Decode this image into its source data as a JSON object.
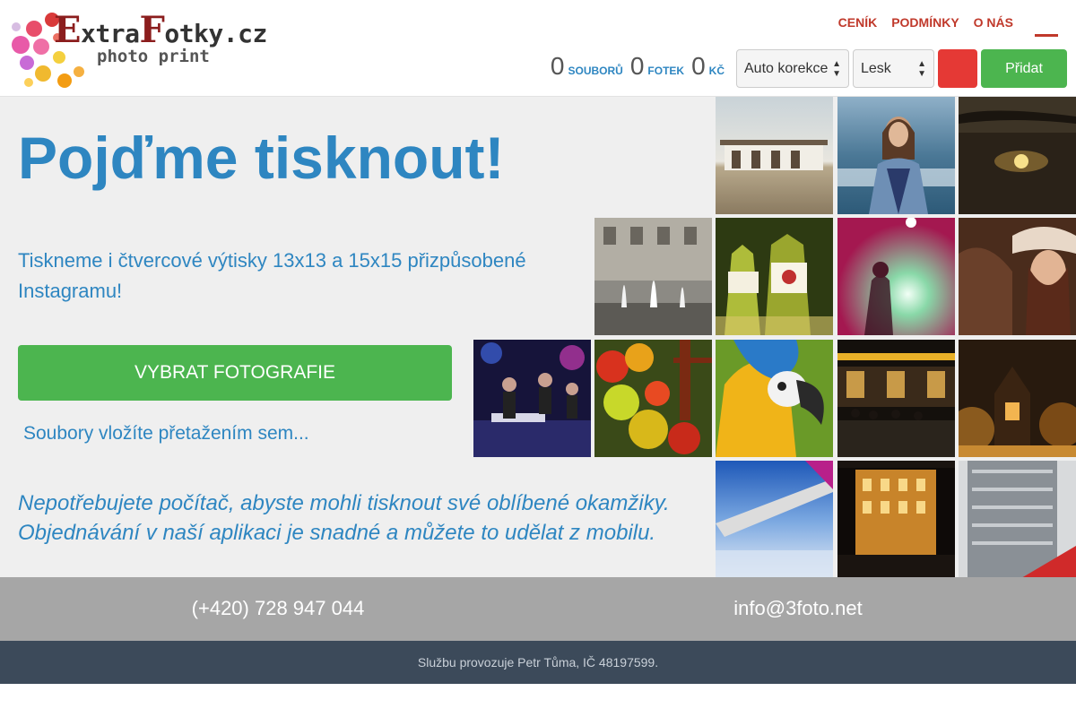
{
  "header": {
    "logo": {
      "title_first_letter": "E",
      "title_part1": "xtra",
      "title_second_letter": "F",
      "title_part2": "otky.cz",
      "subtitle": "photo print"
    },
    "nav": [
      {
        "label": "Ceník"
      },
      {
        "label": "Podmínky"
      },
      {
        "label": "O nás"
      }
    ],
    "counters": {
      "files_count": "0",
      "files_label": "souborů",
      "photos_count": "0",
      "photos_label": "fotek",
      "price_value": "0",
      "price_label": "Kč"
    },
    "correction_select": {
      "value": "Auto korekce"
    },
    "finish_select": {
      "value": "Lesk"
    },
    "add_button": "Přidat",
    "colors": {
      "accent_red": "#c0392b",
      "button_green": "#4cb54f",
      "red_button": "#e53935"
    }
  },
  "main": {
    "heading": "Pojďme tisknout!",
    "subtext": "Tiskneme i čtvercové výtisky 13x13 a 15x15 přizpůsobené Instagramu!",
    "choose_button": "Vybrat fotografie",
    "drop_hint": "Soubory vložíte přetažením sem...",
    "mobile_note": "Nepotřebujete počítač, abyste mohli tisknout své oblíbené okamžiky. Objednávání v naší aplikaci je snadné a můžete to udělat z mobilu.",
    "text_color": "#2e86c1"
  },
  "gallery": [
    {
      "icon": "building-photo"
    },
    {
      "icon": "woman-sea-photo"
    },
    {
      "icon": "sunset-lake-photo"
    },
    {
      "icon": "fountain-photo"
    },
    {
      "icon": "bottles-photo"
    },
    {
      "icon": "concert-light-photo"
    },
    {
      "icon": "cowgirl-horse-photo"
    },
    {
      "icon": "band-stage-photo"
    },
    {
      "icon": "flowers-photo"
    },
    {
      "icon": "parrot-photo"
    },
    {
      "icon": "night-station-photo"
    },
    {
      "icon": "night-garden-photo"
    },
    {
      "icon": "plane-wing-photo"
    },
    {
      "icon": "night-hotel-photo"
    },
    {
      "icon": "modern-building-photo"
    }
  ],
  "contact": {
    "phone": "(+420) 728 947 044",
    "email": "info@3foto.net"
  },
  "footer": {
    "text": "Službu provozuje Petr Tůma, IČ 48197599."
  }
}
